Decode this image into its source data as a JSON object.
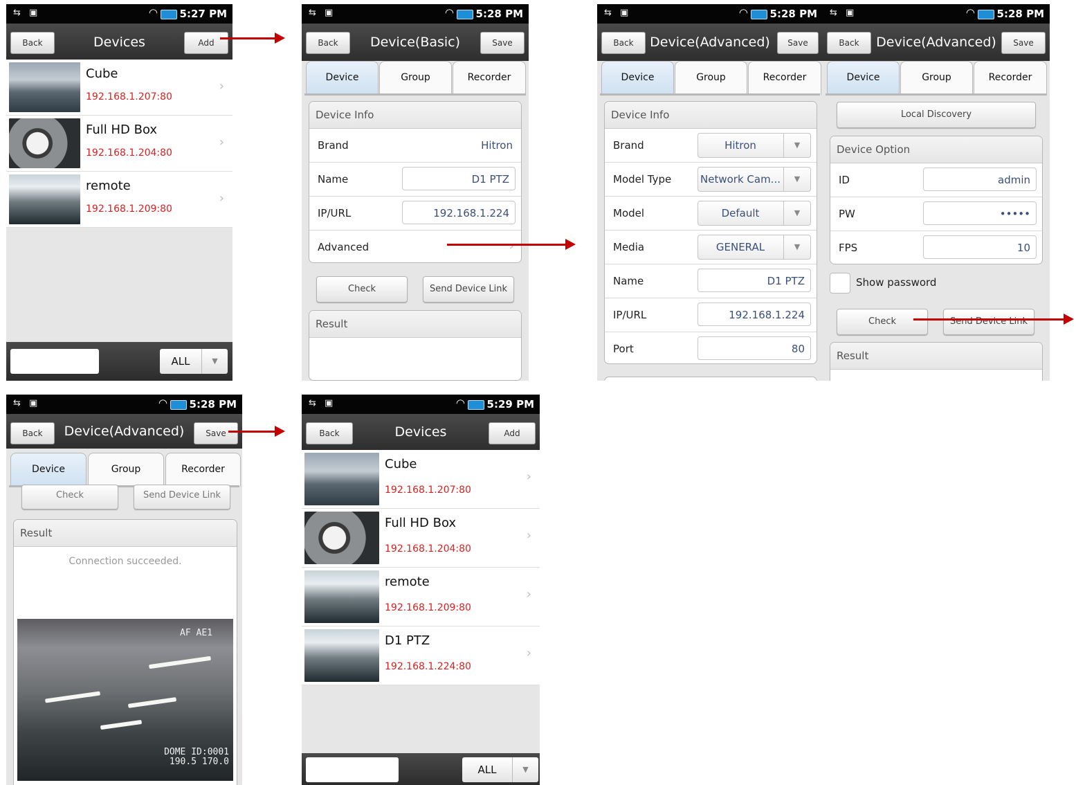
{
  "status": {
    "p1_time": "5:27 PM",
    "p2_time": "5:28 PM",
    "p3_time": "5:28 PM",
    "p4_time": "5:28 PM",
    "p5_time": "5:28 PM",
    "p6_time": "5:29 PM"
  },
  "devices_screen_1": {
    "back": "Back",
    "title": "Devices",
    "add": "Add",
    "items": [
      {
        "name": "Cube",
        "ip": "192.168.1.207:80"
      },
      {
        "name": "Full HD Box",
        "ip": "192.168.1.204:80"
      },
      {
        "name": "remote",
        "ip": "192.168.1.209:80"
      }
    ],
    "filter_value": "ALL"
  },
  "device_basic": {
    "back": "Back",
    "title": "Device(Basic)",
    "save": "Save",
    "tabs": [
      "Device",
      "Group",
      "Recorder"
    ],
    "section": "Device Info",
    "rows": {
      "brand_label": "Brand",
      "brand_value": "Hitron",
      "name_label": "Name",
      "name_value": "D1 PTZ",
      "ip_label": "IP/URL",
      "ip_value": "192.168.1.224",
      "advanced_label": "Advanced"
    },
    "check": "Check",
    "send_link": "Send Device Link",
    "result": "Result"
  },
  "device_advanced_a": {
    "back": "Back",
    "title": "Device(Advanced)",
    "save": "Save",
    "tabs": [
      "Device",
      "Group",
      "Recorder"
    ],
    "section": "Device Info",
    "rows": {
      "brand_label": "Brand",
      "brand_value": "Hitron",
      "model_type_label": "Model Type",
      "model_type_value": "Network Cam...",
      "model_label": "Model",
      "model_value": "Default",
      "media_label": "Media",
      "media_value": "GENERAL",
      "name_label": "Name",
      "name_value": "D1 PTZ",
      "ip_label": "IP/URL",
      "ip_value": "192.168.1.224",
      "port_label": "Port",
      "port_value": "80"
    }
  },
  "device_advanced_b": {
    "back": "Back",
    "title": "Device(Advanced)",
    "save": "Save",
    "tabs": [
      "Device",
      "Group",
      "Recorder"
    ],
    "local_discovery": "Local Discovery",
    "section": "Device Option",
    "rows": {
      "id_label": "ID",
      "id_value": "admin",
      "pw_label": "PW",
      "pw_value": "•••••",
      "fps_label": "FPS",
      "fps_value": "10"
    },
    "show_password": "Show password",
    "check": "Check",
    "send_link": "Send Device Link",
    "result": "Result"
  },
  "device_advanced_result": {
    "back": "Back",
    "title": "Device(Advanced)",
    "save": "Save",
    "tabs": [
      "Device",
      "Group",
      "Recorder"
    ],
    "check": "Check",
    "send_link": "Send Device Link",
    "result": "Result",
    "message": "Connection succeeded.",
    "osd_top": "AF AE1",
    "osd_bottom_1": "DOME ID:0001",
    "osd_bottom_2": "190.5 170.0"
  },
  "devices_screen_2": {
    "back": "Back",
    "title": "Devices",
    "add": "Add",
    "items": [
      {
        "name": "Cube",
        "ip": "192.168.1.207:80"
      },
      {
        "name": "Full HD Box",
        "ip": "192.168.1.204:80"
      },
      {
        "name": "remote",
        "ip": "192.168.1.209:80"
      },
      {
        "name": "D1 PTZ",
        "ip": "192.168.1.224:80"
      }
    ],
    "filter_value": "ALL"
  },
  "colors": {
    "arrow": "#c40000",
    "ip_text": "#dd1f1f",
    "active_tab": "#cfe1f1"
  }
}
